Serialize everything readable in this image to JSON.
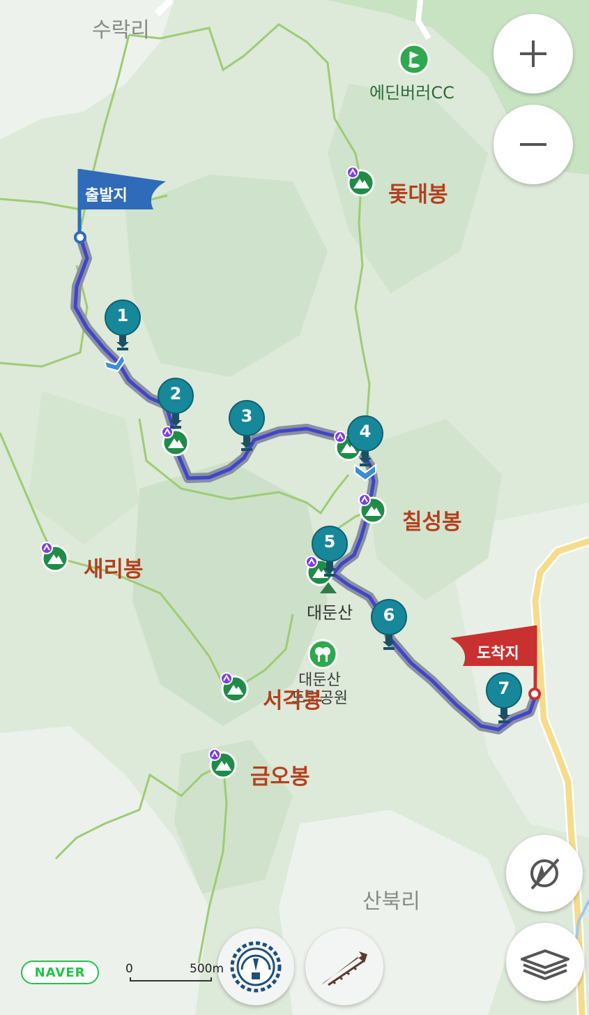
{
  "map": {
    "villages": {
      "suraki": "수락리",
      "sanbukri": "산북리"
    },
    "golf": {
      "label": "에딘버러CC"
    },
    "peaks": {
      "otdaebong": "돛대봉",
      "chilseongbong": "칠성봉",
      "saeribong": "새리봉",
      "seogakbong": "서각봉",
      "geumobong": "금오봉"
    },
    "mountain": {
      "label": "대둔산"
    },
    "park": {
      "line1": "대둔산",
      "line2": "도립공원"
    }
  },
  "route": {
    "start_label": "출발지",
    "end_label": "도착지",
    "waypoints": [
      "1",
      "2",
      "3",
      "4",
      "5",
      "6",
      "7"
    ]
  },
  "controls": {
    "zoom_in": "+",
    "zoom_out": "−"
  },
  "footer": {
    "naver_logo": "NAVER",
    "scale_zero": "0",
    "scale_max": "500m"
  },
  "colors": {
    "route": "#3f46c9",
    "marker": "#16889a",
    "start_flag": "#2f6bb8",
    "end_flag": "#c8312f",
    "peak_icon": "#1f8c48",
    "trail": "#9dcc74"
  },
  "icons": [
    "plus-icon",
    "minus-icon",
    "compass-icon",
    "layers-icon",
    "speedometer-icon",
    "elevation-icon",
    "golf-icon",
    "park-tree-icon",
    "mountain-peak-icon"
  ]
}
